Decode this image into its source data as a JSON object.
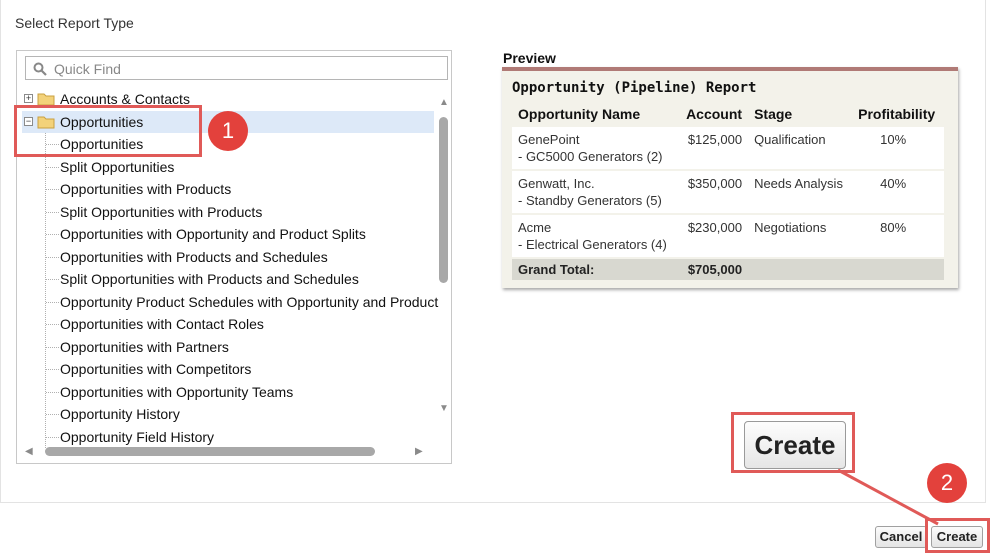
{
  "header": {
    "title": "Select Report Type"
  },
  "search": {
    "placeholder": "Quick Find"
  },
  "tree": {
    "items": [
      {
        "label": "Accounts & Contacts",
        "kind": "folder",
        "expander": "+"
      },
      {
        "label": "Opportunities",
        "kind": "folder",
        "expander": "−",
        "selected": true
      },
      {
        "label": "Opportunities",
        "kind": "child"
      },
      {
        "label": "Split Opportunities",
        "kind": "child"
      },
      {
        "label": "Opportunities with Products",
        "kind": "child"
      },
      {
        "label": "Split Opportunities with Products",
        "kind": "child"
      },
      {
        "label": "Opportunities with Opportunity and Product Splits",
        "kind": "child"
      },
      {
        "label": "Opportunities with Products and Schedules",
        "kind": "child"
      },
      {
        "label": "Split Opportunities with Products and Schedules",
        "kind": "child"
      },
      {
        "label": "Opportunity Product Schedules with Opportunity and Product",
        "kind": "child"
      },
      {
        "label": "Opportunities with Contact Roles",
        "kind": "child"
      },
      {
        "label": "Opportunities with Partners",
        "kind": "child"
      },
      {
        "label": "Opportunities with Competitors",
        "kind": "child"
      },
      {
        "label": "Opportunities with Opportunity Teams",
        "kind": "child"
      },
      {
        "label": "Opportunity History",
        "kind": "child"
      },
      {
        "label": "Opportunity Field History",
        "kind": "child"
      }
    ]
  },
  "preview": {
    "heading": "Preview",
    "report_title": "Opportunity (Pipeline) Report",
    "columns": [
      "Opportunity Name",
      "Account",
      "Stage",
      "Profitability"
    ],
    "rows": [
      {
        "name": "GenePoint",
        "sub": "- GC5000 Generators (2)",
        "account": "$125,000",
        "stage": "Qualification",
        "profit": "10%"
      },
      {
        "name": "Genwatt, Inc.",
        "sub": "- Standby Generators (5)",
        "account": "$350,000",
        "stage": "Needs Analysis",
        "profit": "40%"
      },
      {
        "name": "Acme",
        "sub": "- Electrical Generators (4)",
        "account": "$230,000",
        "stage": "Negotiations",
        "profit": "80%"
      }
    ],
    "total_label": "Grand Total:",
    "total_value": "$705,000"
  },
  "annotations": {
    "step1": "1",
    "step2": "2",
    "highlight_color": "#e05a58",
    "badge_color": "#e3413c"
  },
  "buttons": {
    "create_large": "Create",
    "cancel": "Cancel",
    "create": "Create"
  }
}
